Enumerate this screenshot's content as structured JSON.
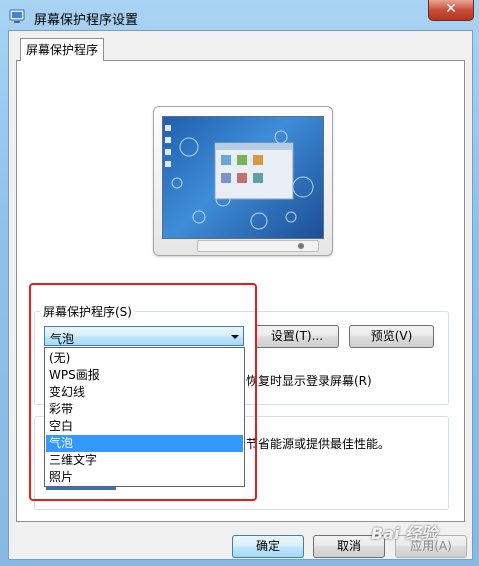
{
  "window": {
    "title": "屏幕保护程序设置",
    "close_glyph": "✕"
  },
  "tabs": [
    {
      "label": "屏幕保护程序"
    }
  ],
  "screensaver": {
    "group_label": "屏幕保护程序(S)",
    "selected": "气泡",
    "options": [
      "(无)",
      "WPS画报",
      "变幻线",
      "彩带",
      "空白",
      "气泡",
      "三维文字",
      "照片"
    ],
    "selected_index": 5,
    "settings_label": "设置(T)...",
    "preview_label": "预览(V)",
    "resume_text": "恢复时显示登录屏幕(R)"
  },
  "power": {
    "text": "节省能源或提供最佳性能。"
  },
  "footer": {
    "ok_label": "确定",
    "cancel_label": "取消",
    "apply_label": "应用(A)"
  },
  "watermark": {
    "text": "Bai 经验"
  },
  "colors": {
    "highlight": "#e51d1d",
    "selection": "#3399ff",
    "accent": "#3c7fb1"
  }
}
